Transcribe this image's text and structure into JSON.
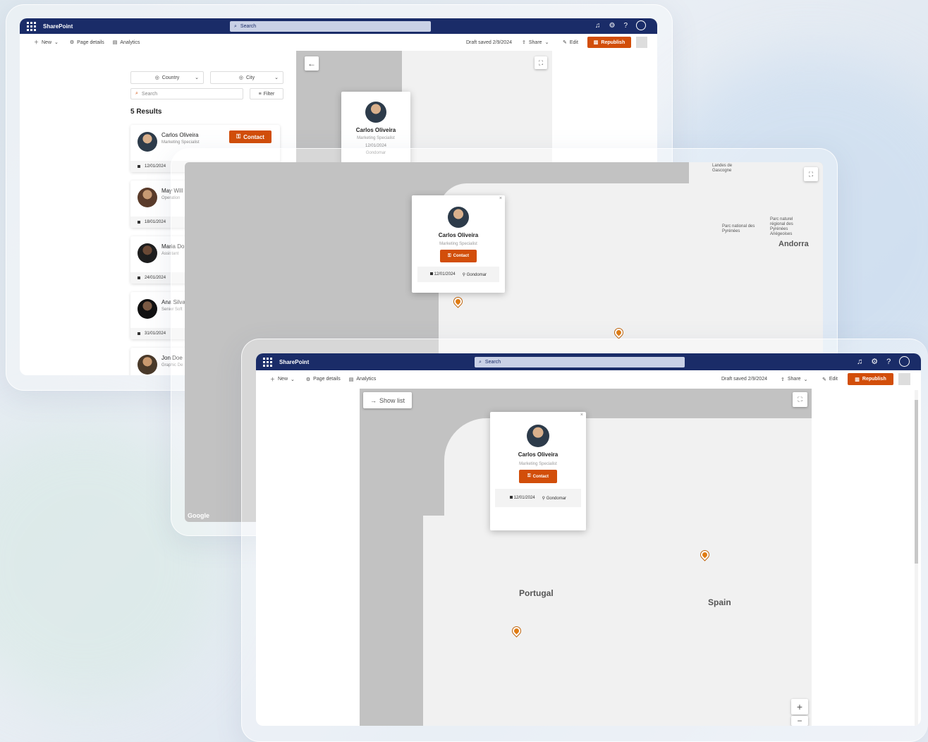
{
  "suitebar": {
    "brand": "SharePoint",
    "search_placeholder": "Search"
  },
  "cmdbar": {
    "new": "New",
    "page_details": "Page details",
    "analytics": "Analytics",
    "draft_saved": "Draft saved 2/9/2024",
    "share": "Share",
    "edit": "Edit",
    "republish": "Republish"
  },
  "filters": {
    "country": "Country",
    "city": "City",
    "search_placeholder": "Search",
    "filter": "Filter",
    "results": "5 Results"
  },
  "people": [
    {
      "name": "Carlos Oliveira",
      "role": "Marketing Specialist",
      "date": "12/01/2024",
      "city": "Gondomar"
    },
    {
      "name": "May Will",
      "role": "Operation",
      "date": "18/01/2024"
    },
    {
      "name": "Maria Do",
      "role": "Assistant",
      "date": "24/01/2024"
    },
    {
      "name": "Ana Silva",
      "role": "Senior Soft",
      "date": "31/01/2024"
    },
    {
      "name": "Jon Doe",
      "role": "Graphic De",
      "date": ""
    }
  ],
  "contact_label": "Contact",
  "map": {
    "show_list": "Show list",
    "google": "Google",
    "labels": {
      "portugal": "Portugal",
      "spain": "Spain",
      "andorra": "Andorra",
      "landes": "Landes de Gascogne",
      "parc_national": "Parc national des Pyrénées",
      "parc_naturel": "Parc naturel régional des Pyrénées Ariégeoises"
    },
    "zoom_in": "+",
    "zoom_out": "−"
  },
  "icons": {
    "waffle": "waffle-icon",
    "search": "search-icon",
    "bell": "bell-icon",
    "gear": "gear-icon",
    "help": "help-icon",
    "expand": "expand-icon",
    "arrow_left": "arrow-left-icon",
    "arrow_right": "arrow-right-icon",
    "pin": "map-pin-icon",
    "calendar": "calendar-icon"
  },
  "colors": {
    "suitebar": "#1a2c68",
    "accent": "#d24e0a",
    "pin": "#e07b12",
    "map_water": "#c2c2c2",
    "map_land": "#f1f1f1"
  }
}
